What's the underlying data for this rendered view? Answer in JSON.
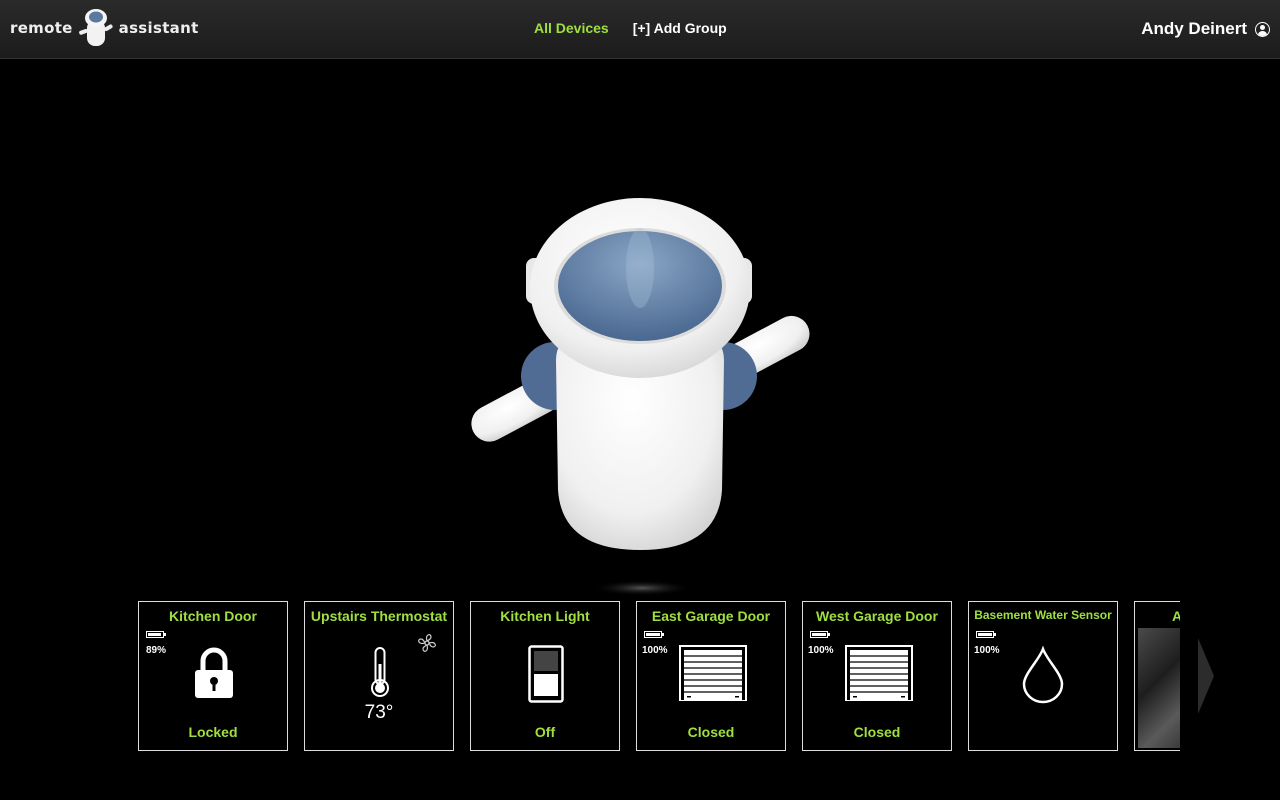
{
  "header": {
    "logo_left": "remote",
    "logo_right": "assistant",
    "nav": [
      {
        "label": "All Devices",
        "active": true
      },
      {
        "label": "[+] Add Group",
        "active": false
      }
    ],
    "user_name": "Andy Deinert"
  },
  "devices": [
    {
      "title": "Kitchen Door",
      "battery": "89%",
      "battery_level": 0.89,
      "status": "Locked",
      "icon": "lock-icon"
    },
    {
      "title": "Upstairs Thermostat",
      "temperature": "73°",
      "icon": "thermometer-icon",
      "fan_icon": "fan-icon"
    },
    {
      "title": "Kitchen Light",
      "status": "Off",
      "icon": "light-switch-icon"
    },
    {
      "title": "East Garage Door",
      "battery": "100%",
      "battery_level": 1.0,
      "status": "Closed",
      "icon": "garage-door-icon"
    },
    {
      "title": "West Garage Door",
      "battery": "100%",
      "battery_level": 1.0,
      "status": "Closed",
      "icon": "garage-door-icon"
    },
    {
      "title": "Basement Water Sensor",
      "battery": "100%",
      "battery_level": 1.0,
      "icon": "water-drop-icon"
    },
    {
      "title": "A",
      "icon": "camera-thumbnail"
    }
  ],
  "colors": {
    "accent": "#9fdf40",
    "background": "#000000",
    "header": "#222222",
    "visor": "#5a7aa0"
  }
}
